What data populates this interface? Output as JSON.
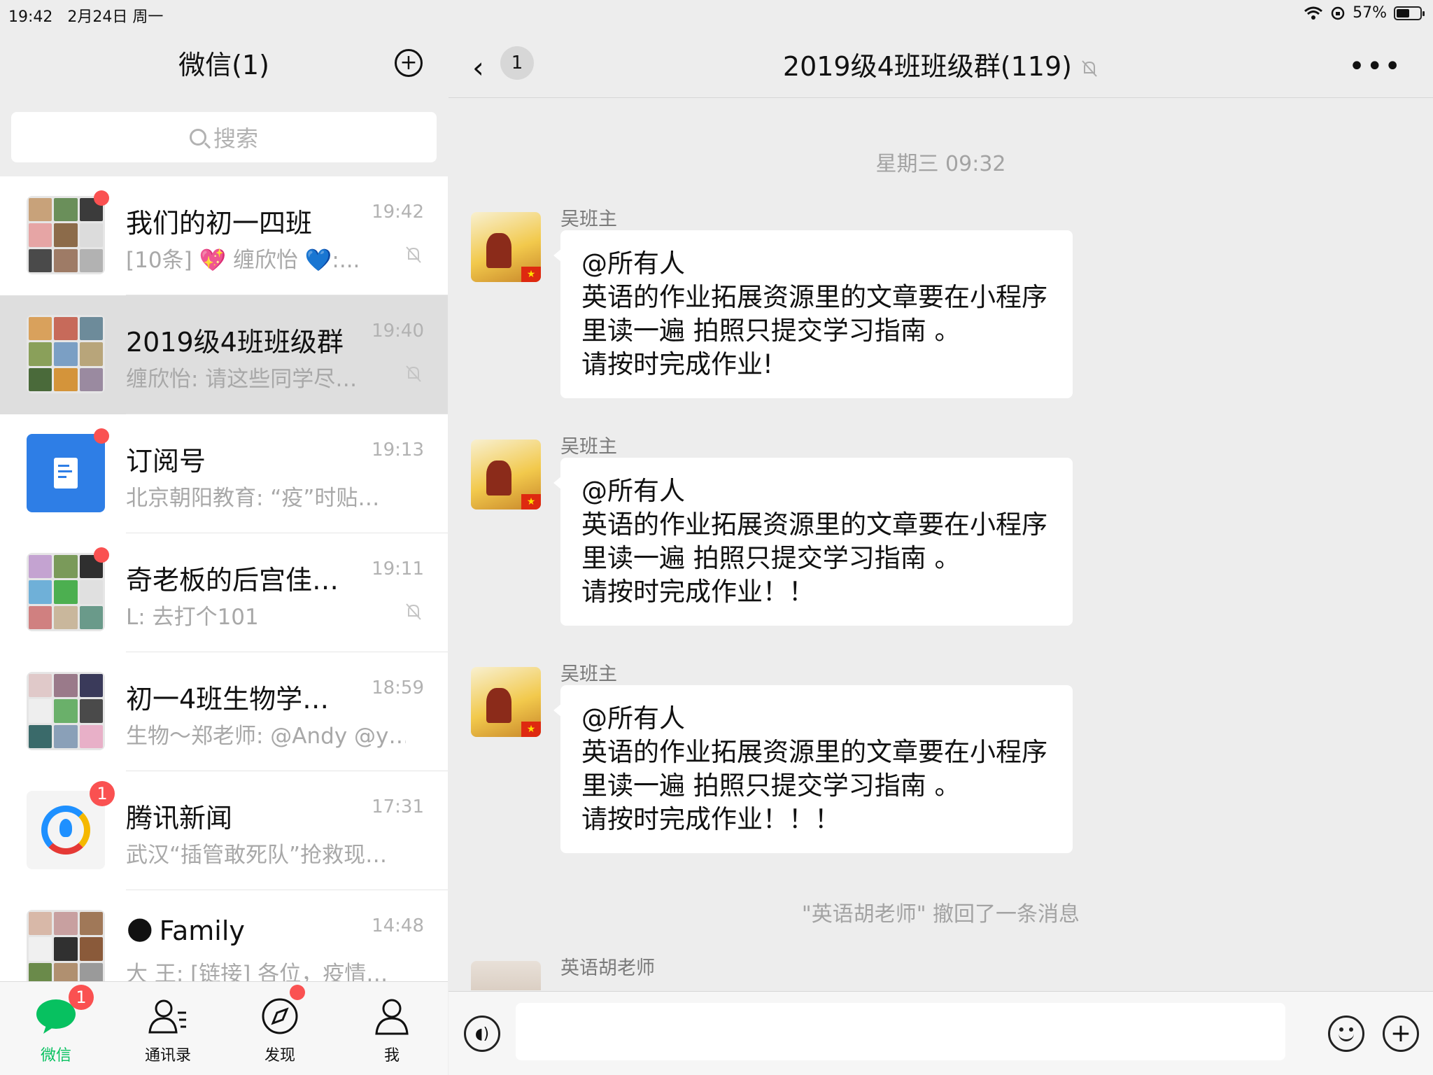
{
  "status_bar": {
    "time": "19:42",
    "date": "2月24日 周一",
    "battery": "57%",
    "battery_level": 0.57,
    "icons": [
      "wifi-icon",
      "orientation-lock-icon",
      "battery-icon"
    ]
  },
  "left": {
    "title": "微信(1)",
    "search_placeholder": "搜索",
    "conversations": [
      {
        "name": "我们的初一四班",
        "time": "19:42",
        "preview": "[10条] 💖 缠欣怡 💙:...",
        "muted": true,
        "badge": "dot",
        "avatar_colors": [
          "#c8a27a",
          "#6a8f5a",
          "#3b3b3b",
          "#e6a5a5",
          "#8c6b4a",
          "#dcdcdc",
          "#4a4a4a",
          "#9e7b66",
          "#b2b2b2"
        ]
      },
      {
        "name": "2019级4班班级群",
        "time": "19:40",
        "preview": "缠欣怡: 请这些同学尽…",
        "muted": true,
        "badge": "",
        "selected": true,
        "avatar_colors": [
          "#d9a15c",
          "#c76a5a",
          "#6d8b9a",
          "#8aa05a",
          "#7b9fc4",
          "#b8a57a",
          "#4a6a3a",
          "#d4943a",
          "#9a8aa0"
        ]
      },
      {
        "name": "订阅号",
        "time": "19:13",
        "preview": "北京朝阳教育: “疫”时贴…",
        "muted": false,
        "badge": "dot"
      },
      {
        "name": "奇老板的后宫佳…",
        "time": "19:11",
        "preview": "L: 去打个101",
        "muted": true,
        "badge": "dot",
        "avatar_colors": [
          "#c4a3d1",
          "#7a9a5a",
          "#2f2f2f",
          "#6fb0d8",
          "#4caf50",
          "#e0e0e0",
          "#d08080",
          "#c9b79c",
          "#6a9a8a"
        ]
      },
      {
        "name": "初一4班生物学…",
        "time": "18:59",
        "preview": "生物～郑老师: @Andy @y…",
        "muted": false,
        "badge": "",
        "avatar_colors": [
          "#e0c9c9",
          "#9a7a8a",
          "#3a3a5a",
          "#eeeeee",
          "#6ab06a",
          "#4a4a4a",
          "#3a6a6a",
          "#8aa0b8",
          "#e8b0c8"
        ]
      },
      {
        "name": "腾讯新闻",
        "time": "17:31",
        "preview": "武汉“插管敢死队”抢救现…",
        "muted": false,
        "badge": "1"
      },
      {
        "name": "Family",
        "time": "14:48",
        "preview": "大 王: [链接] 各位，疫情…",
        "muted": false,
        "badge": "",
        "emoji": "🌑",
        "avatar_colors": [
          "#d8b8a8",
          "#c8a0a0",
          "#a07858",
          "#f0f0f0",
          "#303030",
          "#8a5a3a",
          "#6a8a4a",
          "#b09070",
          "#9a9a9a"
        ]
      }
    ],
    "tabs": [
      {
        "label": "微信",
        "icon": "chat-bubble-icon",
        "active": true,
        "badge": "1"
      },
      {
        "label": "通讯录",
        "icon": "contacts-icon",
        "active": false,
        "badge": ""
      },
      {
        "label": "发现",
        "icon": "compass-icon",
        "active": false,
        "badge": "dot"
      },
      {
        "label": "我",
        "icon": "person-icon",
        "active": false,
        "badge": ""
      }
    ]
  },
  "chat": {
    "back_count": "1",
    "title": "2019级4班班级群(119)",
    "timestamp": "星期三 09:32",
    "messages": [
      {
        "sender": "吴班主",
        "text": "@所有人\n英语的作业拓展资源里的文章要在小程序里读一遍 拍照只提交学习指南 。\n请按时完成作业!"
      },
      {
        "sender": "吴班主",
        "text": "@所有人\n英语的作业拓展资源里的文章要在小程序里读一遍 拍照只提交学习指南 。\n请按时完成作业！！"
      },
      {
        "sender": "吴班主",
        "text": "@所有人\n英语的作业拓展资源里的文章要在小程序里读一遍 拍照只提交学习指南 。\n请按时完成作业！！！"
      }
    ],
    "system_notice": "\"英语胡老师\" 撤回了一条消息",
    "next_sender": "英语胡老师",
    "input_value": ""
  },
  "colors": {
    "accent": "#07c160",
    "badge": "#fa5151"
  }
}
